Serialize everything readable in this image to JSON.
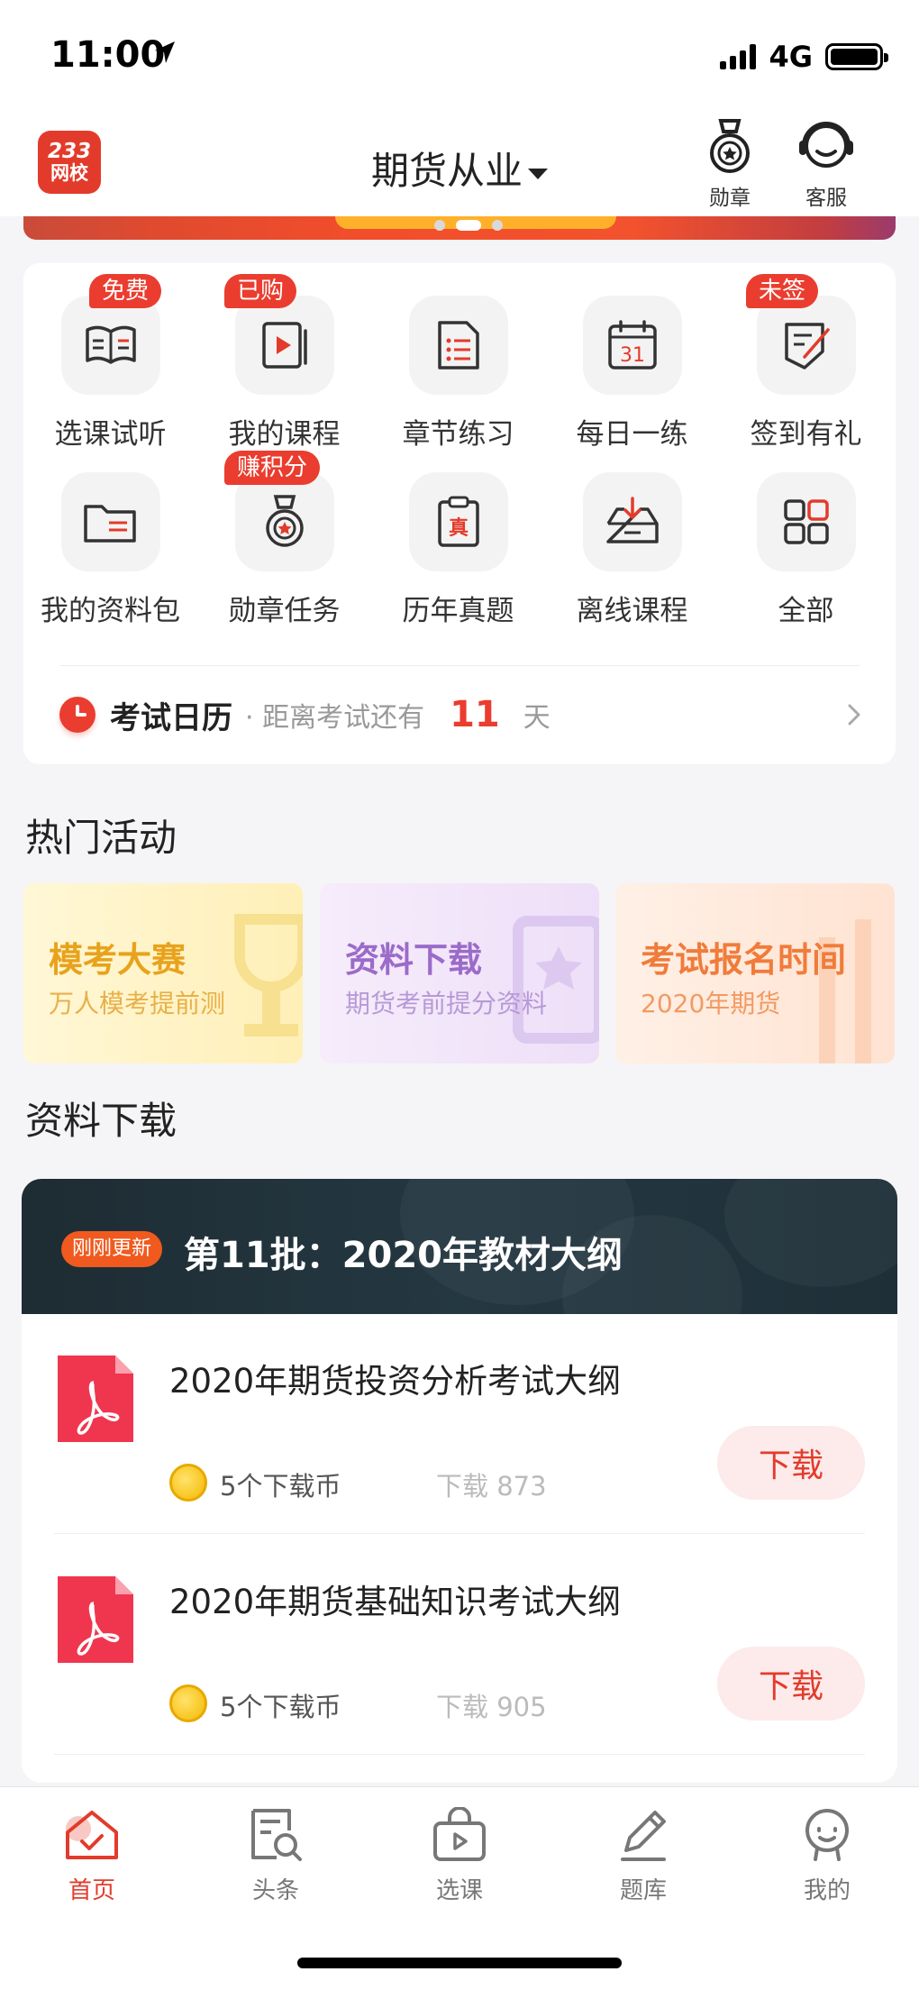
{
  "status": {
    "time": "11:00",
    "network": "4G"
  },
  "header": {
    "logo_top": "233",
    "logo_bottom": "网校",
    "title": "期货从业",
    "badge_label": "勋章",
    "service_label": "客服"
  },
  "menu": {
    "row1": [
      {
        "label": "选课试听",
        "tag": "免费",
        "icon": "open-book-icon"
      },
      {
        "label": "我的课程",
        "tag": "已购",
        "icon": "video-book-icon"
      },
      {
        "label": "章节练习",
        "tag": "",
        "icon": "document-list-icon"
      },
      {
        "label": "每日一练",
        "tag": "",
        "icon": "calendar-icon",
        "icon_text": "31"
      },
      {
        "label": "签到有礼",
        "tag": "未签",
        "icon": "sign-in-icon"
      }
    ],
    "row2": [
      {
        "label": "我的资料包",
        "tag": "",
        "icon": "folder-icon"
      },
      {
        "label": "勋章任务",
        "tag": "赚积分",
        "icon": "medal-icon"
      },
      {
        "label": "历年真题",
        "tag": "",
        "icon": "clipboard-icon",
        "icon_text": "真"
      },
      {
        "label": "离线课程",
        "tag": "",
        "icon": "download-tray-icon"
      },
      {
        "label": "全部",
        "tag": "",
        "icon": "grid-icon"
      }
    ]
  },
  "exam_calendar": {
    "title": "考试日历",
    "prefix": "· 距离考试还有",
    "days": "11",
    "unit": "天"
  },
  "hot_activities": {
    "title": "热门活动",
    "items": [
      {
        "title": "模考大赛",
        "subtitle": "万人模考提前测"
      },
      {
        "title": "资料下载",
        "subtitle": "期货考前提分资料"
      },
      {
        "title": "考试报名时间",
        "subtitle": "2020年期货"
      }
    ]
  },
  "downloads": {
    "section_title": "资料下载",
    "new_tag": "刚刚更新",
    "batch_title": "第11批：2020年教材大纲",
    "items": [
      {
        "name": "2020年期货投资分析考试大纲",
        "price": "5个下载币",
        "count": "下载 873",
        "button": "下载"
      },
      {
        "name": "2020年期货基础知识考试大纲",
        "price": "5个下载币",
        "count": "下载 905",
        "button": "下载"
      }
    ]
  },
  "tabs": [
    {
      "label": "首页",
      "icon": "home-icon",
      "active": true
    },
    {
      "label": "头条",
      "icon": "news-icon",
      "active": false
    },
    {
      "label": "选课",
      "icon": "course-bag-icon",
      "active": false
    },
    {
      "label": "题库",
      "icon": "pencil-icon",
      "active": false
    },
    {
      "label": "我的",
      "icon": "profile-icon",
      "active": false
    }
  ],
  "colors": {
    "accent": "#e33b2b",
    "tag": "#ea3d2f",
    "orange_tag": "#f05a1f"
  }
}
